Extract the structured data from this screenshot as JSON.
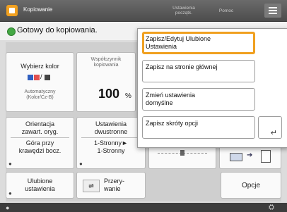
{
  "app": {
    "title": "Kopiowanie",
    "reset_label": "Ustawienia\npoczątk.",
    "help_label": "Pomoc",
    "menu_icon": "hamburger-menu-icon",
    "status": "Gotowy do kopiowania."
  },
  "tiles": {
    "color": {
      "label": "Wybierz kolor",
      "sub": "Automatyczny\n(Kolor/Cz-B)",
      "swatch_colors": [
        "#2f5fc0",
        "#444444"
      ]
    },
    "density": {
      "label": "Współczynnik\nkopiowania",
      "value": "100",
      "unit": "%"
    },
    "orientation": {
      "label": "Orientacja\nzawart. oryg.",
      "value": "Góra przy\nkrawędzi bocz."
    },
    "duplex": {
      "label": "Ustawienia\ndwustronne",
      "value": "1-Stronny►\n1-Stronny"
    },
    "favorites": {
      "label": "Ulubione\nustawienia"
    },
    "interrupt": {
      "label": "Przery-\nwanie"
    },
    "options": {
      "label": "Opcje"
    }
  },
  "menu": {
    "items": [
      {
        "label": "Zapisz/Edytuj Ulubione\nUstawienia",
        "selected": true
      },
      {
        "label": "Zapisz na stronie głównej",
        "selected": false
      },
      {
        "label": "Zmień ustawienia\ndomyślne",
        "selected": false
      },
      {
        "label": "Zapisz skróty opcji",
        "selected": false
      }
    ],
    "enter_icon": "enter-arrow-icon"
  },
  "accent_color": "#f0a020",
  "status_color": "#44a844"
}
